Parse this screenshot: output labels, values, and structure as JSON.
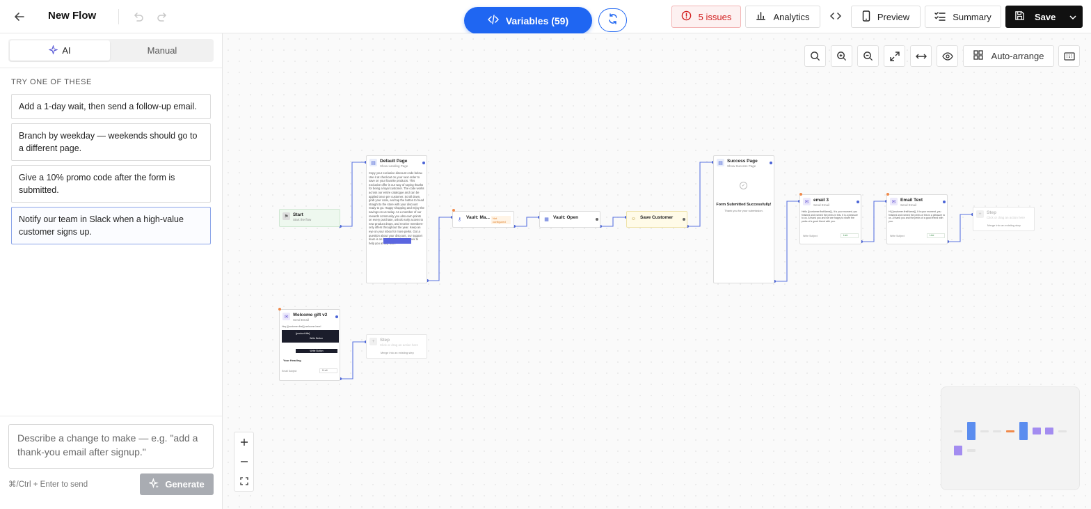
{
  "header": {
    "title": "New Flow",
    "variables_label": "Variables (59)",
    "issues_label": "5 issues",
    "analytics_label": "Analytics",
    "preview_label": "Preview",
    "summary_label": "Summary",
    "save_label": "Save"
  },
  "sidebar": {
    "tabs": [
      {
        "label": "AI"
      },
      {
        "label": "Manual"
      }
    ],
    "suggestions_heading": "TRY ONE OF THESE",
    "suggestions": [
      {
        "text": "Add a 1-day wait, then send a follow-up email."
      },
      {
        "text": "Branch by weekday — weekends should go to a different page."
      },
      {
        "text": "Give a 10% promo code after the form is submitted."
      },
      {
        "text": "Notify our team in Slack when a high-value customer signs up."
      }
    ],
    "prompt_placeholder": "Describe a change to make — e.g. \"add a thank-you email after signup.\"",
    "send_hint": "⌘/Ctrl + Enter to send",
    "generate_label": "Generate"
  },
  "canvas": {
    "auto_arrange_label": "Auto-arrange",
    "nodes": {
      "start": {
        "title": "Start",
        "subtitle": "Start the flow"
      },
      "default_page": {
        "title": "Default Page",
        "subtitle": "Show Landing Page",
        "body": "Copy your exclusive discount code below. Use it at checkout on your next order to save on your favorite products. This exclusive offer is our way of saying thanks for being a loyal customer. The code works across our entire catalogue and can be applied once per customer. Scroll down, grab your code, and tap the button to head straight to the store with your discount ready to go. Happy shopping and enjoy the savings on us today. As a member of our rewards community you also earn points on every purchase, unlock early access to new product drops, and receive members-only offers throughout the year. Keep an eye on your inbox for more perks. Got a question about your discount, our support team is on hand seven days a week to help you at any time."
      },
      "vault_match": {
        "title": "Vault: Ma...",
        "badge": "Not configured"
      },
      "vault_open": {
        "title": "Vault: Open"
      },
      "save_customer": {
        "title": "Save Customer"
      },
      "success_page": {
        "title": "Success Page",
        "subtitle": "Show Success Page",
        "heading": "Form Submitted Successfully!",
        "body": "Thank you for your submission."
      },
      "email3": {
        "title": "email 3",
        "subtitle": "Send Email",
        "body": "Hello {{customer.firstName}}, It is your moment, you finished and earned the perks in this. It is a pleasure to us. A thank you and we are happy to share the perks of a good friend with you.",
        "footer": "Write Subject",
        "tag": "Live"
      },
      "email_text": {
        "title": "Email Text",
        "subtitle": "Send Email",
        "body": "Hi {{customer.firstName}}, It is your moment, you finished and earned the perks of this is a pleasure to us. A thank you and the perks of a good friend with you.",
        "footer": "Write Subject",
        "tag": "Live"
      },
      "step_right": {
        "title": "Step",
        "subtitle": "Click or drag an action here",
        "hint": "Merge into an existing step"
      },
      "welcome_gift": {
        "title": "Welcome gift v2",
        "subtitle": "Send Email",
        "preview_top": "Hey {{customer.first}} welcome here!",
        "banner_text": "{product.title}",
        "button_text": "Write Button",
        "heading_text": "Your Heading",
        "footer": "Email Subject",
        "tag": "Draft"
      },
      "step_bottom": {
        "title": "Step",
        "subtitle": "Click or drag an action here",
        "hint": "Merge into an existing step"
      }
    }
  },
  "colors": {
    "accent": "#1f66f2",
    "issues": "#d21e1e",
    "edge": "#4a63d6",
    "minimap_blue": "#5b8def",
    "minimap_purple": "#a38cf0",
    "minimap_orange": "#f08a4b"
  }
}
